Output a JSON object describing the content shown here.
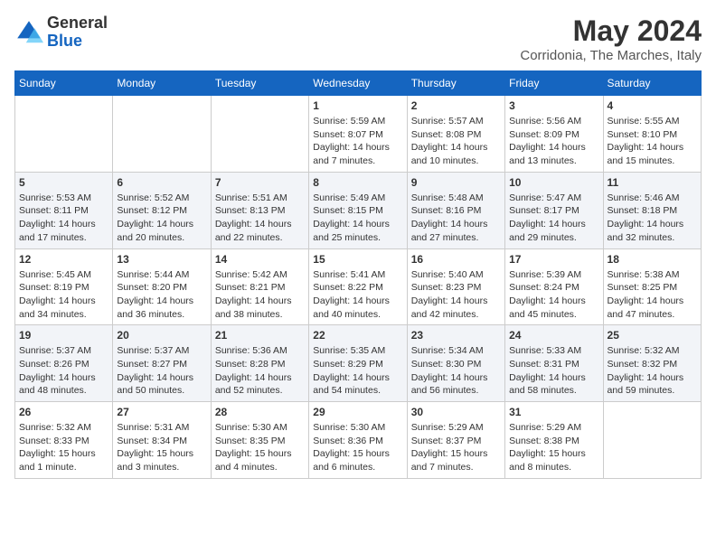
{
  "header": {
    "logo_general": "General",
    "logo_blue": "Blue",
    "month_title": "May 2024",
    "location": "Corridonia, The Marches, Italy"
  },
  "days_of_week": [
    "Sunday",
    "Monday",
    "Tuesday",
    "Wednesday",
    "Thursday",
    "Friday",
    "Saturday"
  ],
  "weeks": [
    [
      {
        "day": null,
        "info": null
      },
      {
        "day": null,
        "info": null
      },
      {
        "day": null,
        "info": null
      },
      {
        "day": "1",
        "info": "Sunrise: 5:59 AM\nSunset: 8:07 PM\nDaylight: 14 hours\nand 7 minutes."
      },
      {
        "day": "2",
        "info": "Sunrise: 5:57 AM\nSunset: 8:08 PM\nDaylight: 14 hours\nand 10 minutes."
      },
      {
        "day": "3",
        "info": "Sunrise: 5:56 AM\nSunset: 8:09 PM\nDaylight: 14 hours\nand 13 minutes."
      },
      {
        "day": "4",
        "info": "Sunrise: 5:55 AM\nSunset: 8:10 PM\nDaylight: 14 hours\nand 15 minutes."
      }
    ],
    [
      {
        "day": "5",
        "info": "Sunrise: 5:53 AM\nSunset: 8:11 PM\nDaylight: 14 hours\nand 17 minutes."
      },
      {
        "day": "6",
        "info": "Sunrise: 5:52 AM\nSunset: 8:12 PM\nDaylight: 14 hours\nand 20 minutes."
      },
      {
        "day": "7",
        "info": "Sunrise: 5:51 AM\nSunset: 8:13 PM\nDaylight: 14 hours\nand 22 minutes."
      },
      {
        "day": "8",
        "info": "Sunrise: 5:49 AM\nSunset: 8:15 PM\nDaylight: 14 hours\nand 25 minutes."
      },
      {
        "day": "9",
        "info": "Sunrise: 5:48 AM\nSunset: 8:16 PM\nDaylight: 14 hours\nand 27 minutes."
      },
      {
        "day": "10",
        "info": "Sunrise: 5:47 AM\nSunset: 8:17 PM\nDaylight: 14 hours\nand 29 minutes."
      },
      {
        "day": "11",
        "info": "Sunrise: 5:46 AM\nSunset: 8:18 PM\nDaylight: 14 hours\nand 32 minutes."
      }
    ],
    [
      {
        "day": "12",
        "info": "Sunrise: 5:45 AM\nSunset: 8:19 PM\nDaylight: 14 hours\nand 34 minutes."
      },
      {
        "day": "13",
        "info": "Sunrise: 5:44 AM\nSunset: 8:20 PM\nDaylight: 14 hours\nand 36 minutes."
      },
      {
        "day": "14",
        "info": "Sunrise: 5:42 AM\nSunset: 8:21 PM\nDaylight: 14 hours\nand 38 minutes."
      },
      {
        "day": "15",
        "info": "Sunrise: 5:41 AM\nSunset: 8:22 PM\nDaylight: 14 hours\nand 40 minutes."
      },
      {
        "day": "16",
        "info": "Sunrise: 5:40 AM\nSunset: 8:23 PM\nDaylight: 14 hours\nand 42 minutes."
      },
      {
        "day": "17",
        "info": "Sunrise: 5:39 AM\nSunset: 8:24 PM\nDaylight: 14 hours\nand 45 minutes."
      },
      {
        "day": "18",
        "info": "Sunrise: 5:38 AM\nSunset: 8:25 PM\nDaylight: 14 hours\nand 47 minutes."
      }
    ],
    [
      {
        "day": "19",
        "info": "Sunrise: 5:37 AM\nSunset: 8:26 PM\nDaylight: 14 hours\nand 48 minutes."
      },
      {
        "day": "20",
        "info": "Sunrise: 5:37 AM\nSunset: 8:27 PM\nDaylight: 14 hours\nand 50 minutes."
      },
      {
        "day": "21",
        "info": "Sunrise: 5:36 AM\nSunset: 8:28 PM\nDaylight: 14 hours\nand 52 minutes."
      },
      {
        "day": "22",
        "info": "Sunrise: 5:35 AM\nSunset: 8:29 PM\nDaylight: 14 hours\nand 54 minutes."
      },
      {
        "day": "23",
        "info": "Sunrise: 5:34 AM\nSunset: 8:30 PM\nDaylight: 14 hours\nand 56 minutes."
      },
      {
        "day": "24",
        "info": "Sunrise: 5:33 AM\nSunset: 8:31 PM\nDaylight: 14 hours\nand 58 minutes."
      },
      {
        "day": "25",
        "info": "Sunrise: 5:32 AM\nSunset: 8:32 PM\nDaylight: 14 hours\nand 59 minutes."
      }
    ],
    [
      {
        "day": "26",
        "info": "Sunrise: 5:32 AM\nSunset: 8:33 PM\nDaylight: 15 hours\nand 1 minute."
      },
      {
        "day": "27",
        "info": "Sunrise: 5:31 AM\nSunset: 8:34 PM\nDaylight: 15 hours\nand 3 minutes."
      },
      {
        "day": "28",
        "info": "Sunrise: 5:30 AM\nSunset: 8:35 PM\nDaylight: 15 hours\nand 4 minutes."
      },
      {
        "day": "29",
        "info": "Sunrise: 5:30 AM\nSunset: 8:36 PM\nDaylight: 15 hours\nand 6 minutes."
      },
      {
        "day": "30",
        "info": "Sunrise: 5:29 AM\nSunset: 8:37 PM\nDaylight: 15 hours\nand 7 minutes."
      },
      {
        "day": "31",
        "info": "Sunrise: 5:29 AM\nSunset: 8:38 PM\nDaylight: 15 hours\nand 8 minutes."
      },
      {
        "day": null,
        "info": null
      }
    ]
  ]
}
